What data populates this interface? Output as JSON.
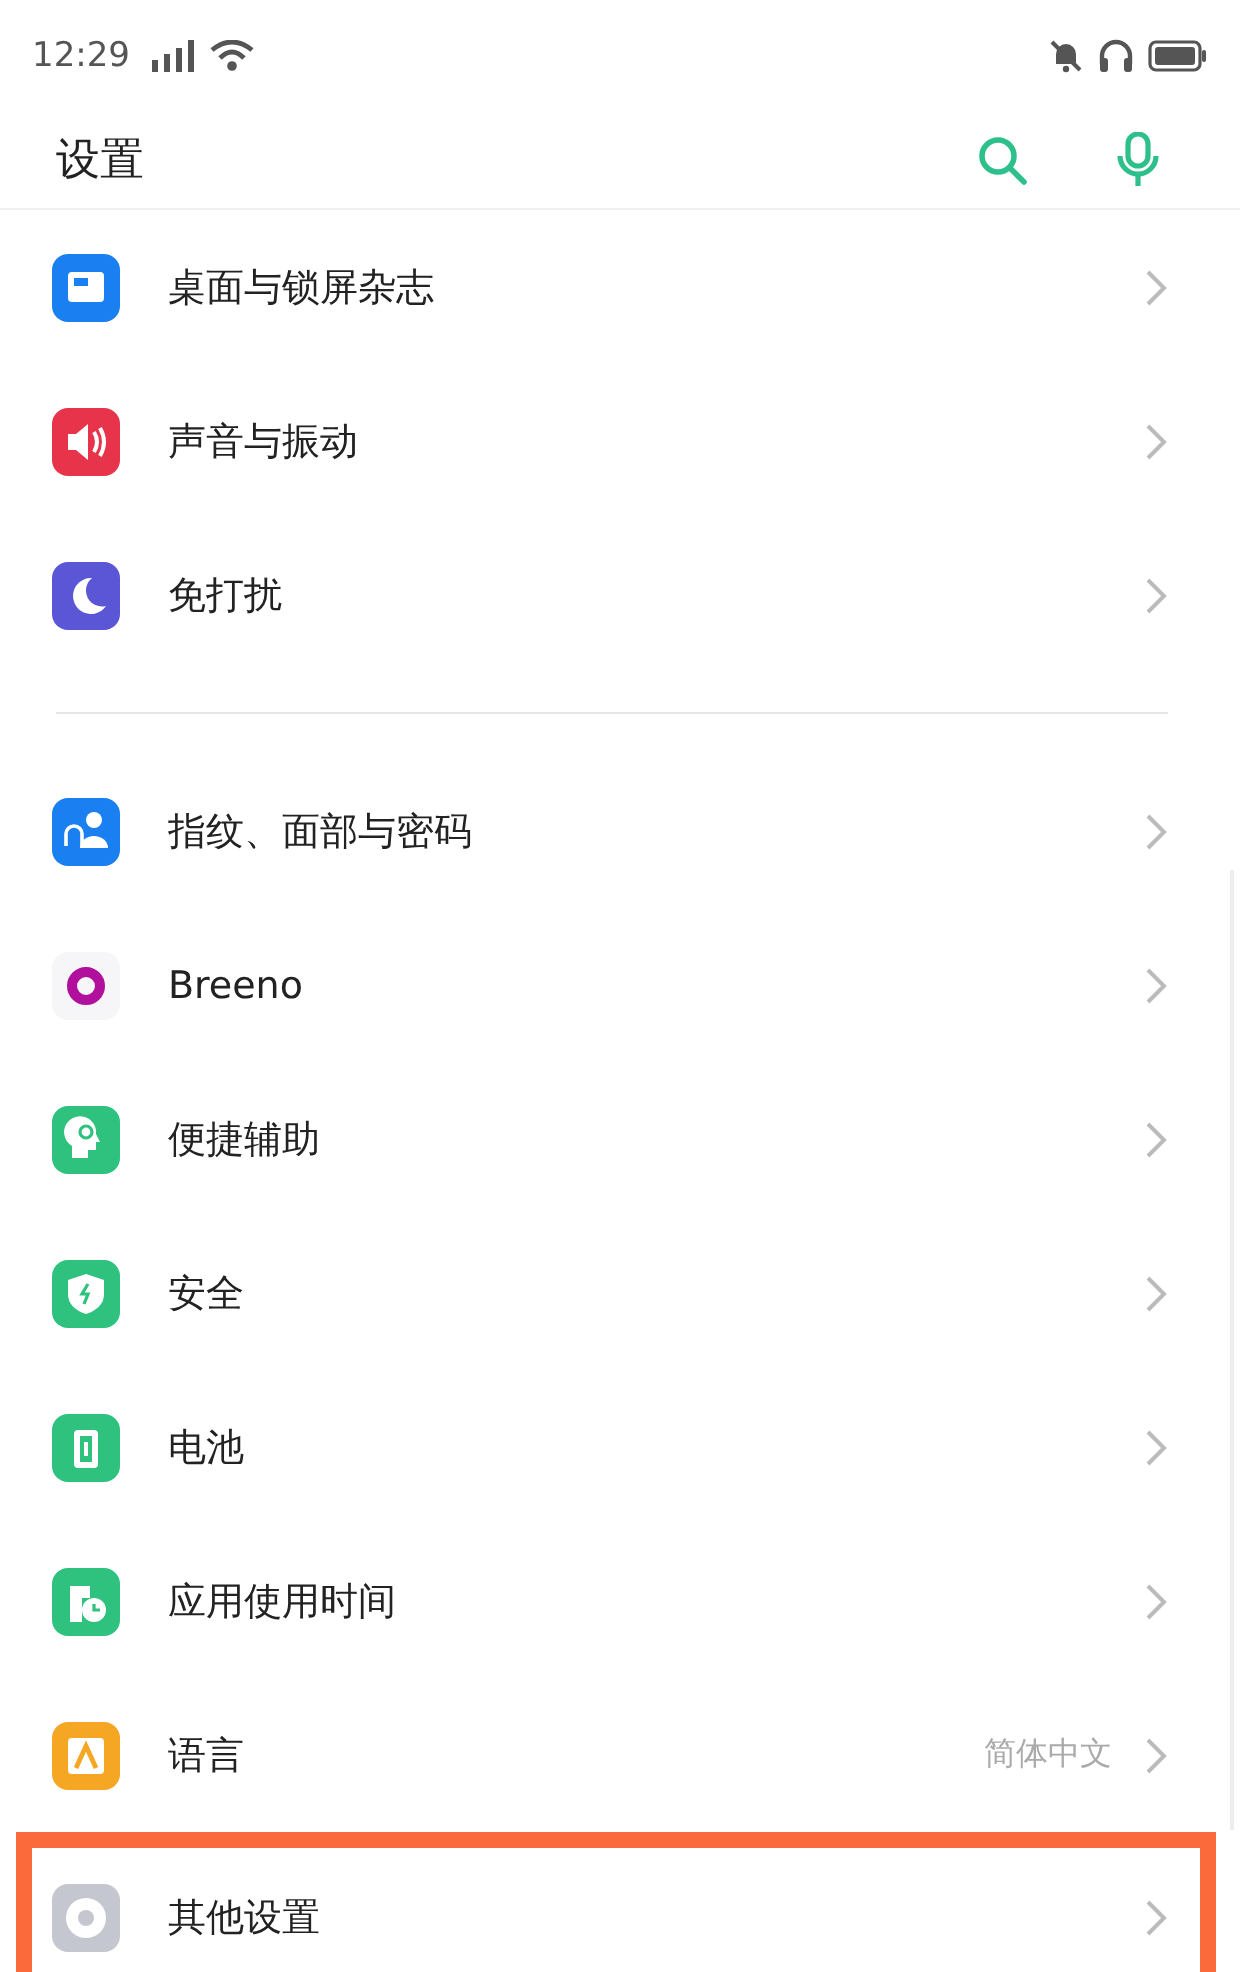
{
  "status_bar": {
    "time": "12:29"
  },
  "header": {
    "title": "设置"
  },
  "groups": [
    {
      "items": [
        {
          "kind": "wallpaper",
          "color": "#1a7ff0",
          "label": "桌面与锁屏杂志",
          "highlighted": false
        },
        {
          "kind": "sound",
          "color": "#e8344a",
          "label": "声音与振动",
          "highlighted": false
        },
        {
          "kind": "moon",
          "color": "#5b56d6",
          "label": "免打扰",
          "highlighted": false
        }
      ]
    },
    {
      "items": [
        {
          "kind": "fingerprint",
          "color": "#1a7ff0",
          "label": "指纹、面部与密码",
          "highlighted": false
        },
        {
          "kind": "ring",
          "color": "#b0109c",
          "label": "Breeno",
          "highlighted": false
        },
        {
          "kind": "head",
          "color": "#2ec27e",
          "label": "便捷辅助",
          "highlighted": false
        },
        {
          "kind": "shield",
          "color": "#2ec27e",
          "label": "安全",
          "highlighted": false
        },
        {
          "kind": "battery",
          "color": "#2ec27e",
          "label": "电池",
          "highlighted": false
        },
        {
          "kind": "clock",
          "color": "#2ec27e",
          "label": "应用使用时间",
          "highlighted": false
        },
        {
          "kind": "letter",
          "color": "#f5a623",
          "label": "语言",
          "value": "简体中文",
          "highlighted": false
        },
        {
          "kind": "gear",
          "color": "#c4c7cf",
          "label": "其他设置",
          "highlighted": true
        }
      ]
    }
  ]
}
